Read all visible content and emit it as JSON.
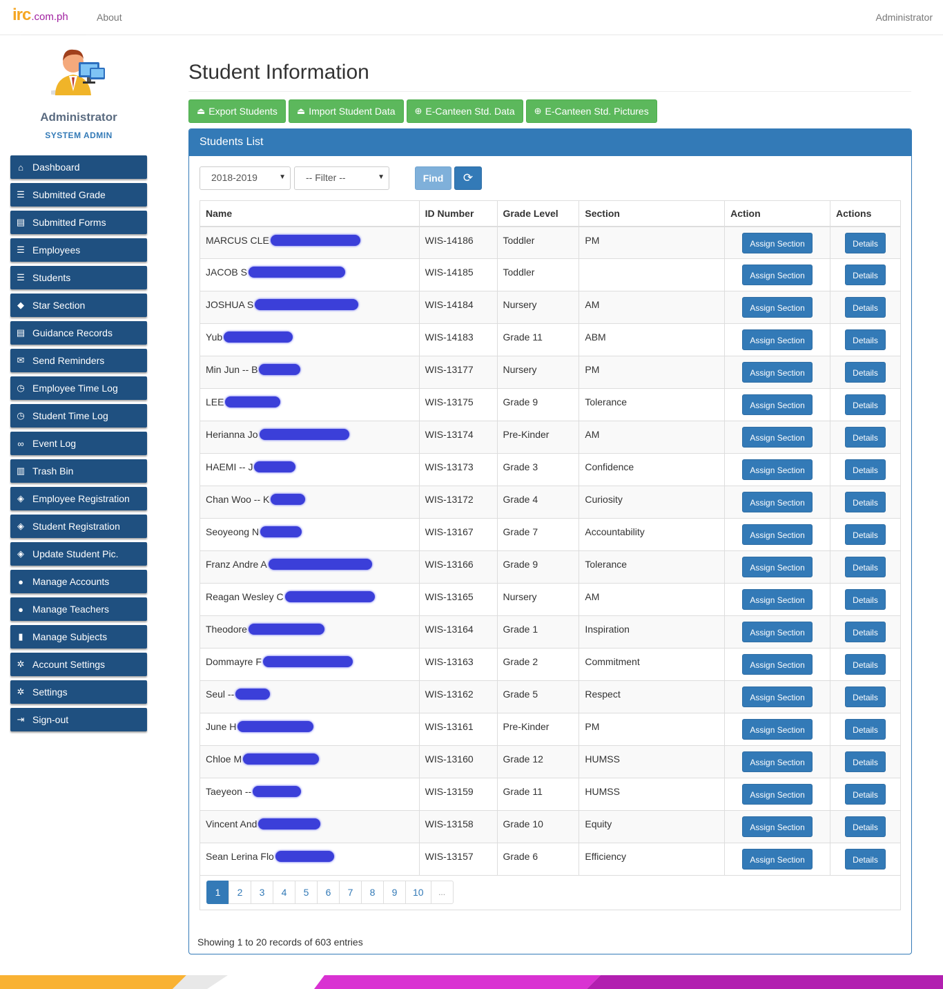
{
  "navbar": {
    "brand_main": "irc",
    "brand_domain": ".com.ph",
    "about": "About",
    "user": "Administrator"
  },
  "profile": {
    "name": "Administrator",
    "role": "SYSTEM ADMIN"
  },
  "menu": [
    {
      "label": "Dashboard",
      "icon": "home-icon",
      "glyph": "⌂"
    },
    {
      "label": "Submitted Grade",
      "icon": "list-icon",
      "glyph": "☰"
    },
    {
      "label": "Submitted Forms",
      "icon": "list-alt-icon",
      "glyph": "▤"
    },
    {
      "label": "Employees",
      "icon": "list-icon",
      "glyph": "☰"
    },
    {
      "label": "Students",
      "icon": "list-icon",
      "glyph": "☰"
    },
    {
      "label": "Star Section",
      "icon": "graduation-cap-icon",
      "glyph": "◆"
    },
    {
      "label": "Guidance Records",
      "icon": "list-alt-icon",
      "glyph": "▤"
    },
    {
      "label": "Send Reminders",
      "icon": "envelope-icon",
      "glyph": "✉"
    },
    {
      "label": "Employee Time Log",
      "icon": "clock-icon",
      "glyph": "◷"
    },
    {
      "label": "Student Time Log",
      "icon": "clock-icon",
      "glyph": "◷"
    },
    {
      "label": "Event Log",
      "icon": "sunglasses-icon",
      "glyph": "∞"
    },
    {
      "label": "Trash Bin",
      "icon": "trash-icon",
      "glyph": "▥"
    },
    {
      "label": "Employee Registration",
      "icon": "tags-icon",
      "glyph": "◈"
    },
    {
      "label": "Student Registration",
      "icon": "tags-icon",
      "glyph": "◈"
    },
    {
      "label": "Update Student Pic.",
      "icon": "tags-icon",
      "glyph": "◈"
    },
    {
      "label": "Manage Accounts",
      "icon": "user-icon",
      "glyph": "●"
    },
    {
      "label": "Manage Teachers",
      "icon": "user-icon",
      "glyph": "●"
    },
    {
      "label": "Manage Subjects",
      "icon": "book-icon",
      "glyph": "▮"
    },
    {
      "label": "Account Settings",
      "icon": "cog-icon",
      "glyph": "✲"
    },
    {
      "label": "Settings",
      "icon": "cog-icon",
      "glyph": "✲"
    },
    {
      "label": "Sign-out",
      "icon": "log-out-icon",
      "glyph": "⇥"
    }
  ],
  "page": {
    "title": "Student Information"
  },
  "toolbar": [
    {
      "label": "Export Students",
      "icon": "upload-icon",
      "glyph": "⏏"
    },
    {
      "label": "Import Student Data",
      "icon": "import-icon",
      "glyph": "⏏"
    },
    {
      "label": "E-Canteen Std. Data",
      "icon": "download-circle-icon",
      "glyph": "⊕"
    },
    {
      "label": "E-Canteen Std. Pictures",
      "icon": "download-circle-icon",
      "glyph": "⊕"
    }
  ],
  "panel": {
    "heading": "Students List",
    "year_select": "2018-2019",
    "filter_select": "-- Filter --",
    "find_label": "Find",
    "refresh_glyph": "⟳"
  },
  "table": {
    "columns": [
      "Name",
      "ID Number",
      "Grade Level",
      "Section",
      "Action",
      "Actions"
    ],
    "assign_label": "Assign Section",
    "details_label": "Details",
    "rows": [
      {
        "name": "MARCUS CLE",
        "id": "WIS-14186",
        "grade": "Toddler",
        "section": "PM"
      },
      {
        "name": "JACOB S",
        "id": "WIS-14185",
        "grade": "Toddler",
        "section": ""
      },
      {
        "name": "JOSHUA S",
        "id": "WIS-14184",
        "grade": "Nursery",
        "section": "AM"
      },
      {
        "name": "Yub",
        "id": "WIS-14183",
        "grade": "Grade 11",
        "section": "ABM"
      },
      {
        "name": "Min Jun -- B",
        "id": "WIS-13177",
        "grade": "Nursery",
        "section": "PM"
      },
      {
        "name": "LEE",
        "id": "WIS-13175",
        "grade": "Grade 9",
        "section": "Tolerance"
      },
      {
        "name": "Herianna Jo",
        "id": "WIS-13174",
        "grade": "Pre-Kinder",
        "section": "AM"
      },
      {
        "name": "HAEMI -- J",
        "id": "WIS-13173",
        "grade": "Grade 3",
        "section": "Confidence"
      },
      {
        "name": "Chan Woo -- K",
        "id": "WIS-13172",
        "grade": "Grade 4",
        "section": "Curiosity"
      },
      {
        "name": "Seoyeong N",
        "id": "WIS-13167",
        "grade": "Grade 7",
        "section": "Accountability"
      },
      {
        "name": "Franz Andre A",
        "id": "WIS-13166",
        "grade": "Grade 9",
        "section": "Tolerance"
      },
      {
        "name": "Reagan Wesley C",
        "id": "WIS-13165",
        "grade": "Nursery",
        "section": "AM"
      },
      {
        "name": "Theodore",
        "id": "WIS-13164",
        "grade": "Grade 1",
        "section": "Inspiration"
      },
      {
        "name": "Dommayre F",
        "id": "WIS-13163",
        "grade": "Grade 2",
        "section": "Commitment"
      },
      {
        "name": "Seul --",
        "id": "WIS-13162",
        "grade": "Grade 5",
        "section": "Respect"
      },
      {
        "name": "June H",
        "id": "WIS-13161",
        "grade": "Pre-Kinder",
        "section": "PM"
      },
      {
        "name": "Chloe M",
        "id": "WIS-13160",
        "grade": "Grade 12",
        "section": "HUMSS"
      },
      {
        "name": "Taeyeon --",
        "id": "WIS-13159",
        "grade": "Grade 11",
        "section": "HUMSS"
      },
      {
        "name": "Vincent And",
        "id": "WIS-13158",
        "grade": "Grade 10",
        "section": "Equity"
      },
      {
        "name": "Sean Lerina Flo",
        "id": "WIS-13157",
        "grade": "Grade 6",
        "section": "Efficiency"
      }
    ]
  },
  "pagination": {
    "pages": [
      "1",
      "2",
      "3",
      "4",
      "5",
      "6",
      "7",
      "8",
      "9",
      "10",
      "..."
    ],
    "active": "1"
  },
  "summary": "Showing 1 to 20 records of 603 entries",
  "colors": {
    "primary": "#337ab7",
    "success": "#5cb85c",
    "sidebar": "#1f5080",
    "redaction": "#3b3fd9"
  }
}
